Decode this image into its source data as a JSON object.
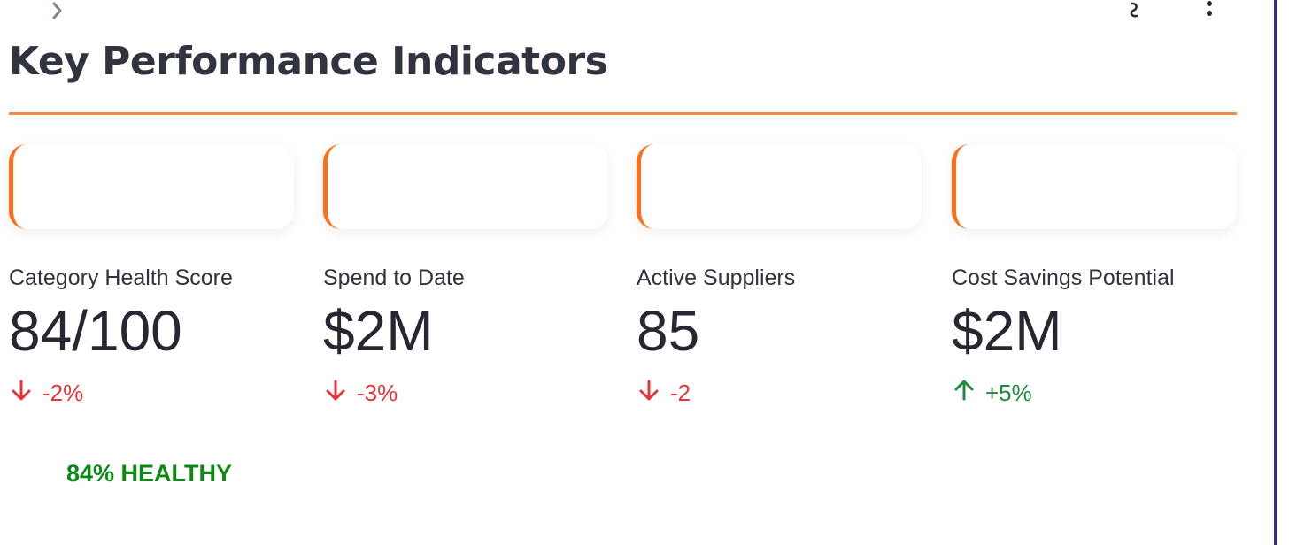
{
  "page": {
    "title": "Key Performance Indicators",
    "accent_color": "#f58a4b",
    "card_border_color": "#ff6f1a"
  },
  "toolbar": {
    "expand_icon": "chevron-right-icon",
    "help_icon": "help-squiggle-icon",
    "menu_icon": "more-vertical-icon"
  },
  "metrics": [
    {
      "label": "Category Health Score",
      "value": "84/100",
      "delta": "-2%",
      "direction": "down"
    },
    {
      "label": "Spend to Date",
      "value": "$2M",
      "delta": "-3%",
      "direction": "down"
    },
    {
      "label": "Active Suppliers",
      "value": "85",
      "delta": "-2",
      "direction": "down"
    },
    {
      "label": "Cost Savings Potential",
      "value": "$2M",
      "delta": "+5%",
      "direction": "up"
    }
  ],
  "status": {
    "health_text": "84% HEALTHY",
    "color": "#0a8a12"
  },
  "colors": {
    "delta_down": "#e8333a",
    "delta_up": "#1e8a3c"
  }
}
